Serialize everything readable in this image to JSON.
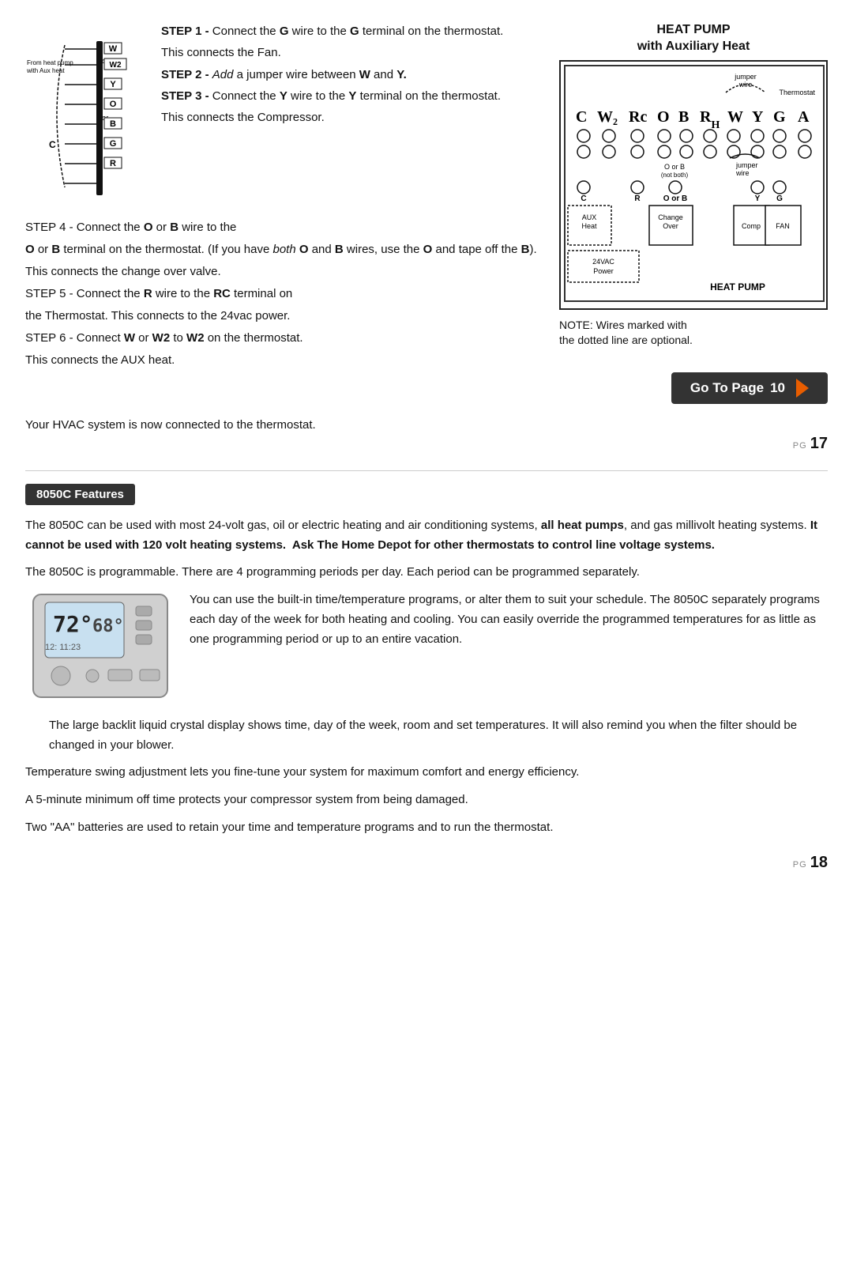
{
  "page17": {
    "left": {
      "step1_label": "STEP 1 -",
      "step1_text": " Connect the ",
      "step1_bold": "G",
      "step1_text2": " wire to the ",
      "step1_bold2": "G",
      "step1_text3": " terminal on the thermostat.",
      "step1_line2": "This connects the Fan.",
      "step2_label": "STEP 2 -",
      "step2_italic": " Add",
      "step2_text": " a jumper wire between ",
      "step2_bold": "W",
      "step2_text2": " and ",
      "step2_bold2": "Y.",
      "step3_label": "STEP 3 -",
      "step3_text": " Connect the ",
      "step3_bold": "Y",
      "step3_text2": " wire to the ",
      "step3_bold2": "Y",
      "step3_text3": " terminal on the thermostat.",
      "step3_line2": "This connects the Compressor.",
      "step4_label": "STEP 4 -",
      "step4_text": " Connect the ",
      "step4_bold": "O",
      "step4_text2": " or ",
      "step4_bold2": "B",
      "step4_text3": " wire to the",
      "para1": "O or B terminal on the thermostat. (If you have both O and B wires, use the O and tape off the B).",
      "para1_both": "both",
      "para1_O1": "O",
      "para1_B1": "B",
      "para1_O2": "O",
      "para1_B2": "B",
      "para1_line2": "This connects the change over valve.",
      "step5_label": "STEP 5 -",
      "step5_text": " Connect the ",
      "step5_bold": "R",
      "step5_text2": " wire to the ",
      "step5_bold2": "RC",
      "step5_text3": " terminal on",
      "step5_line2": "the Thermostat. This connects to the 24vac power.",
      "step6_label": "STEP 6 -",
      "step6_text": " Connect ",
      "step6_bold": "W",
      "step6_text2": " or ",
      "step6_bold2": "W2",
      "step6_text3": " to ",
      "step6_bold3": "W2",
      "step6_text4": " on the thermostat.",
      "step6_line2": "This connects the AUX heat."
    },
    "right": {
      "title_line1": "HEAT PUMP",
      "title_line2": "with Auxiliary Heat",
      "note_line1": "NOTE: Wires marked with",
      "note_line2": "the dotted line are optional.",
      "go_to_page_label": "Go To Page",
      "go_to_page_num": "10"
    },
    "wiring_labels": {
      "from_heat_pump": "From heat pump",
      "with_aux_heat": "with Aux heat",
      "w": "W",
      "or1": "or",
      "w2": "W2",
      "y": "Y",
      "o": "O",
      "or2": "or",
      "b": "B",
      "c": "C",
      "g": "G",
      "r": "R"
    },
    "hp_diagram": {
      "jumper_wire1": "jumper wire",
      "thermostat_label": "Thermostat",
      "terminals": "C W2 Rc O B Rh W Y G A",
      "o_or_b": "O or B",
      "not_both": "(not both)",
      "jumper_wire2": "jumper wire",
      "aux_heat": "AUX Heat",
      "change_over": "Change Over",
      "comp": "Comp",
      "fan": "FAN",
      "24vac": "24VAC Power",
      "heat_pump_label": "HEAT PUMP"
    },
    "hvac_line": "Your HVAC system is now connected to the thermostat.",
    "page_num": "17"
  },
  "page18": {
    "badge_label": "8050C Features",
    "para1": "The 8050C can be used with most 24-volt gas, oil or electric heating and air conditioning systems, all heat pumps, and gas millivolt heating systems. It cannot be used with 120 volt heating systems.  Ask The Home Depot for other thermostats to control line voltage systems.",
    "para1_bold1": "all heat pumps",
    "para1_bold2": "It cannot be used with 120 volt heating systems.  Ask The Home Depot for other thermostats to control line voltage systems.",
    "para2": "The 8050C is programmable. There are 4 programming periods per day. Each period can be programmed separately.",
    "image_text": "You can use the built-in time/temperature programs, or alter them to suit your schedule. The 8050C separately programs each day of the week for both heating and cooling. You can easily override the programmed temperatures for as little as one programming period or up to an entire vacation.",
    "para3": "The large backlit liquid crystal display shows time, day of the week, room and set temperatures. It will also remind you when the filter should be changed in your blower.",
    "para4": "Temperature swing adjustment lets you fine-tune your system for maximum comfort and energy efficiency.",
    "para5": "A 5-minute minimum off time protects your compressor system from being damaged.",
    "para6": "Two \"AA\" batteries are used to retain your time and temperature programs and to run the thermostat.",
    "page_num": "18"
  }
}
